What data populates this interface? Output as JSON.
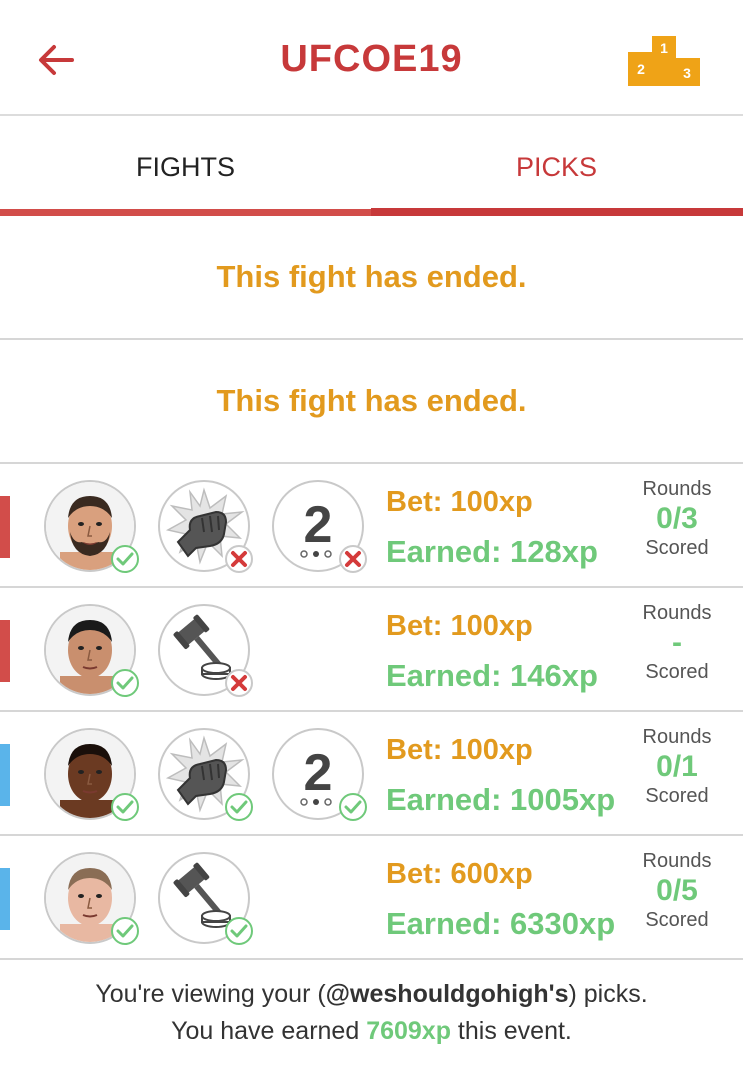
{
  "header": {
    "title": "UFCOE19",
    "back_icon": "arrow-left-icon",
    "leaderboard_icon": "podium-icon",
    "podium": {
      "first": "1",
      "second": "2",
      "third": "3"
    }
  },
  "tabs": [
    {
      "label": "FIGHTS",
      "active": false
    },
    {
      "label": "PICKS",
      "active": true
    }
  ],
  "ended_messages": [
    "This fight has ended.",
    "This fight has ended."
  ],
  "picks": [
    {
      "corner_color": "#d24d4a",
      "fighter_correct": true,
      "method": "ko-icon",
      "method_correct": false,
      "round": "2",
      "round_correct": false,
      "has_round": true,
      "bet": "Bet: 100xp",
      "earned": "Earned: 128xp",
      "rounds_label": "Rounds",
      "rounds_value": "0/3",
      "scored_label": "Scored"
    },
    {
      "corner_color": "#d24d4a",
      "fighter_correct": true,
      "method": "decision-icon",
      "method_correct": false,
      "has_round": false,
      "bet": "Bet: 100xp",
      "earned": "Earned: 146xp",
      "rounds_label": "Rounds",
      "rounds_value": "-",
      "scored_label": "Scored"
    },
    {
      "corner_color": "#5ab4ea",
      "fighter_correct": true,
      "method": "ko-icon",
      "method_correct": true,
      "round": "2",
      "round_correct": true,
      "has_round": true,
      "bet": "Bet: 100xp",
      "earned": "Earned: 1005xp",
      "rounds_label": "Rounds",
      "rounds_value": "0/1",
      "scored_label": "Scored"
    },
    {
      "corner_color": "#5ab4ea",
      "fighter_correct": true,
      "method": "decision-icon",
      "method_correct": true,
      "has_round": false,
      "bet": "Bet: 600xp",
      "earned": "Earned: 6330xp",
      "rounds_label": "Rounds",
      "rounds_value": "0/5",
      "scored_label": "Scored"
    }
  ],
  "footer": {
    "line1_prefix": "You're viewing your (",
    "username": "@weshouldgohigh's",
    "line1_suffix": ") picks.",
    "line2_prefix": "You have earned ",
    "total_xp": "7609xp",
    "line2_suffix": " this event."
  },
  "colors": {
    "accent": "#c7393a",
    "bet": "#e29a1e",
    "earned": "#6fc97a",
    "red_corner": "#d24d4a",
    "blue_corner": "#5ab4ea"
  }
}
